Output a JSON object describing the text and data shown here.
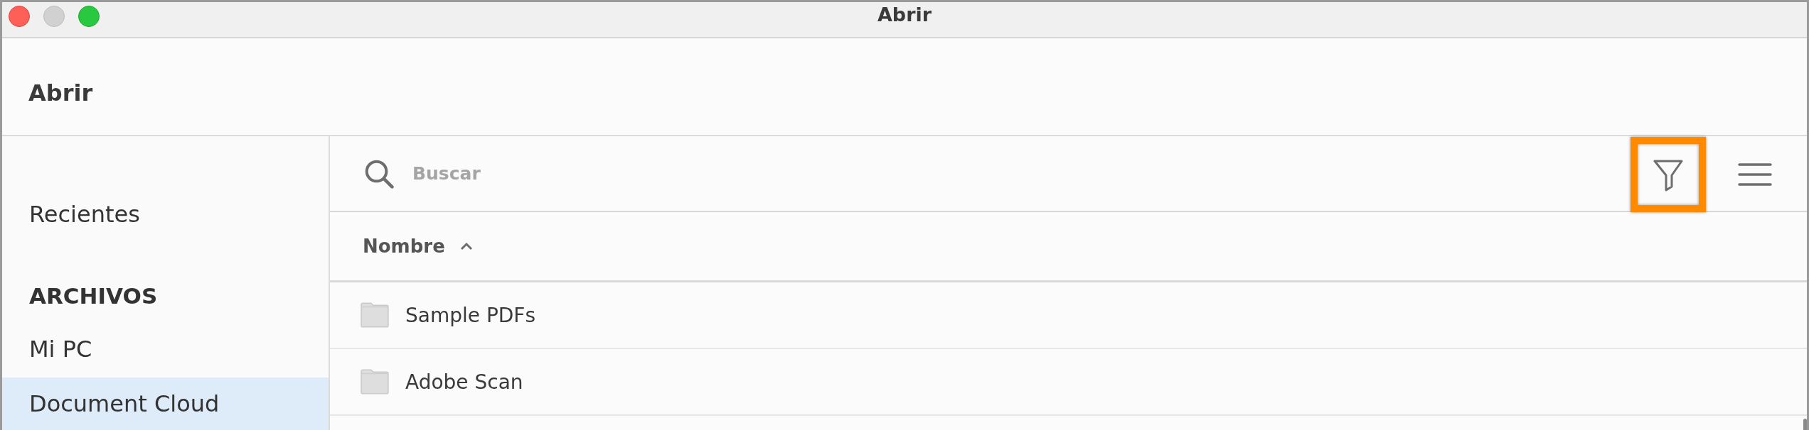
{
  "window": {
    "title": "Abrir"
  },
  "header": {
    "title": "Abrir"
  },
  "sidebar": {
    "items": [
      {
        "kind": "item",
        "label": "Recientes",
        "selected": false
      },
      {
        "kind": "heading",
        "label": "ARCHIVOS"
      },
      {
        "kind": "item",
        "label": "Mi PC",
        "selected": false
      },
      {
        "kind": "item",
        "label": "Document Cloud",
        "selected": true
      }
    ]
  },
  "search": {
    "placeholder": "Buscar"
  },
  "toolbar": {
    "buttons": [
      {
        "kind": "filter",
        "highlighted": true
      },
      {
        "kind": "menu",
        "highlighted": false
      }
    ]
  },
  "table": {
    "columns": [
      {
        "label": "Nombre",
        "sorted_ascending": true
      }
    ],
    "rows": [
      {
        "kind": "folder",
        "name": "Sample PDFs"
      },
      {
        "kind": "folder",
        "name": "Adobe Scan"
      }
    ]
  }
}
